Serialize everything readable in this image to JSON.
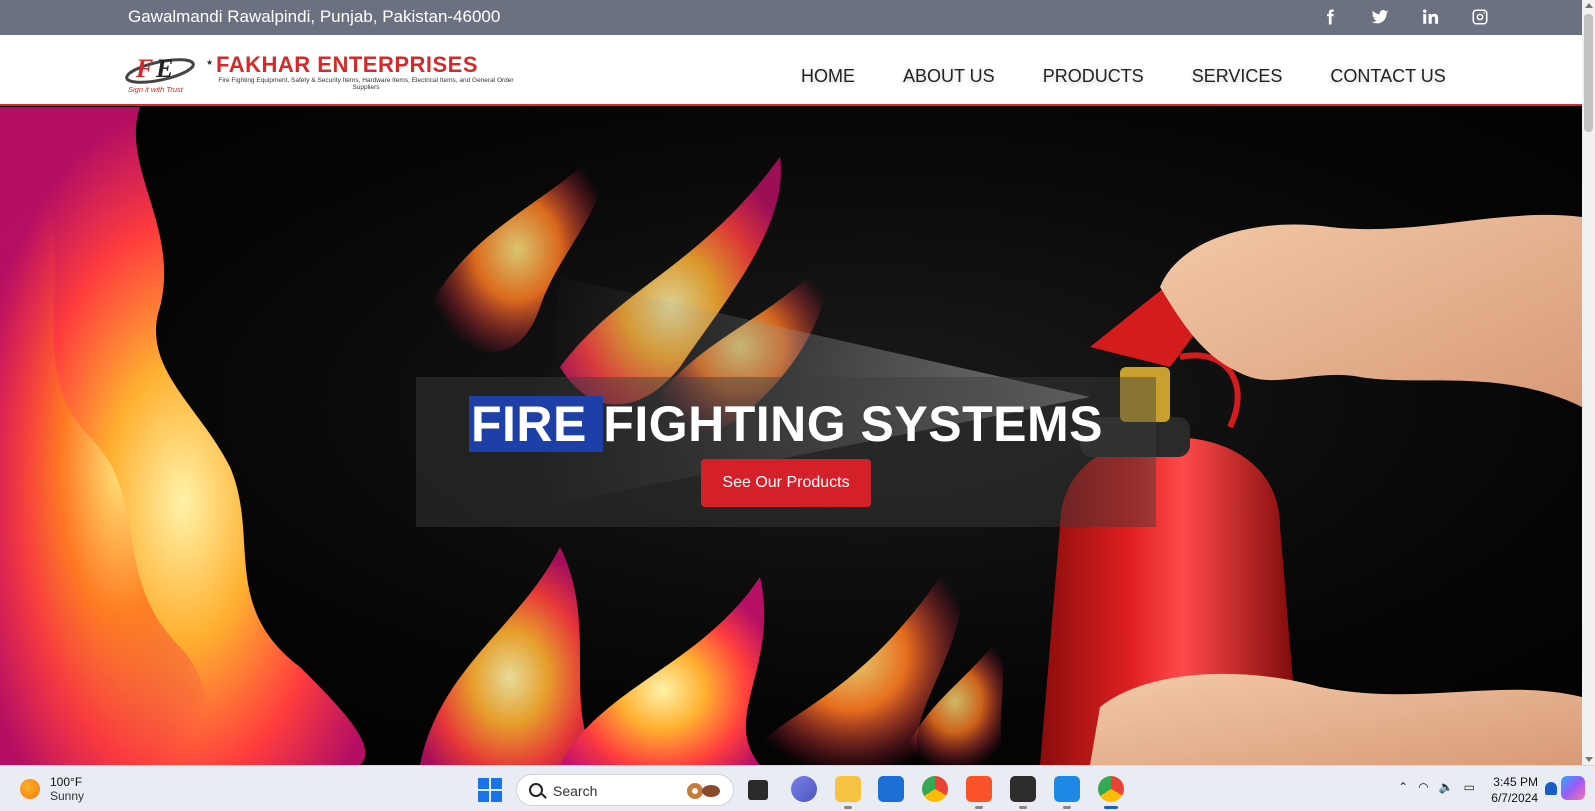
{
  "topbar": {
    "address": "Gawalmandi Rawalpindi, Punjab, Pakistan-46000",
    "socials": [
      "facebook-icon",
      "twitter-icon",
      "linkedin-icon",
      "instagram-icon"
    ]
  },
  "header": {
    "brand": "FAKHAR ENTERPRISES",
    "subtitle": "Fire Fighting Equipment, Safety & Security Items, Hardware Items, Electrical Items, and General Order Suppliers",
    "tagline": "Sign it with Trust",
    "nav": [
      "HOME",
      "ABOUT US",
      "PRODUCTS",
      "SERVICES",
      "CONTACT US"
    ]
  },
  "hero": {
    "title_selected": "FIRE ",
    "title_rest": "FIGHTING SYSTEMS",
    "cta_label": "See Our Products"
  },
  "taskbar": {
    "weather_temp": "100°F",
    "weather_cond": "Sunny",
    "search_placeholder": "Search",
    "time": "3:45 PM",
    "date": "6/7/2024"
  },
  "colors": {
    "topbar": "#6b7180",
    "brand_red": "#d42a2a",
    "cta_red": "#d42028",
    "selection_blue": "#1e3fa8"
  }
}
